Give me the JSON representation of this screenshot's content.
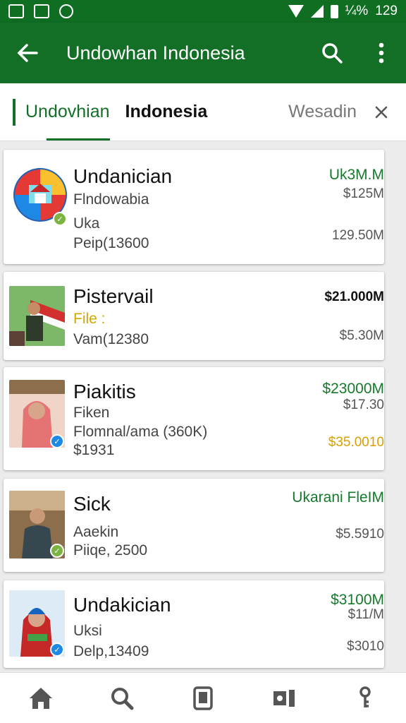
{
  "status_bar": {
    "time": "129",
    "battery_text": "¼%"
  },
  "app_bar": {
    "title": "Undowhan Indonesia"
  },
  "tabs": [
    {
      "label": "Undovhian"
    },
    {
      "label": "Indonesia"
    },
    {
      "label": "Wesadin"
    }
  ],
  "items": [
    {
      "title": "Undanician",
      "line1": "Flndowabia",
      "line2": "Uka",
      "line3": "Peip(13600",
      "price1": "Uk3M.M",
      "price2": "$125M",
      "price3": "129.50M"
    },
    {
      "title": "Pistervail",
      "line1": "File :",
      "line2": "Vam(12380",
      "price1": "$21.000M",
      "price2": "$5.30M"
    },
    {
      "title": "Piakitis",
      "line1": "Fiken",
      "line2": "Flomnal/ama (360K)",
      "line3": "$1931",
      "price1": "$23000M",
      "price2": "$17.30",
      "price3": "$35.0010"
    },
    {
      "title": "Sick",
      "line1": "Aaekin",
      "line2": "Piiqe, 2500",
      "price1": "Ukarani FleIM",
      "price2": "$5.5910"
    },
    {
      "title": "Undakician",
      "line1": "Uksi",
      "line2": "Delp,13409",
      "price1": "$3100M",
      "price2": "$11/M",
      "price3": "$3010"
    }
  ],
  "colors": {
    "primary": "#136f25",
    "accent_yellow": "#d8a000",
    "badge_blue": "#1e88e5"
  },
  "icons": {
    "back": "arrow-left-icon",
    "search": "search-icon",
    "more": "more-vert-icon",
    "close": "close-icon",
    "nav": [
      "home-icon",
      "search-icon",
      "tablet-icon",
      "library-icon",
      "key-icon"
    ]
  }
}
